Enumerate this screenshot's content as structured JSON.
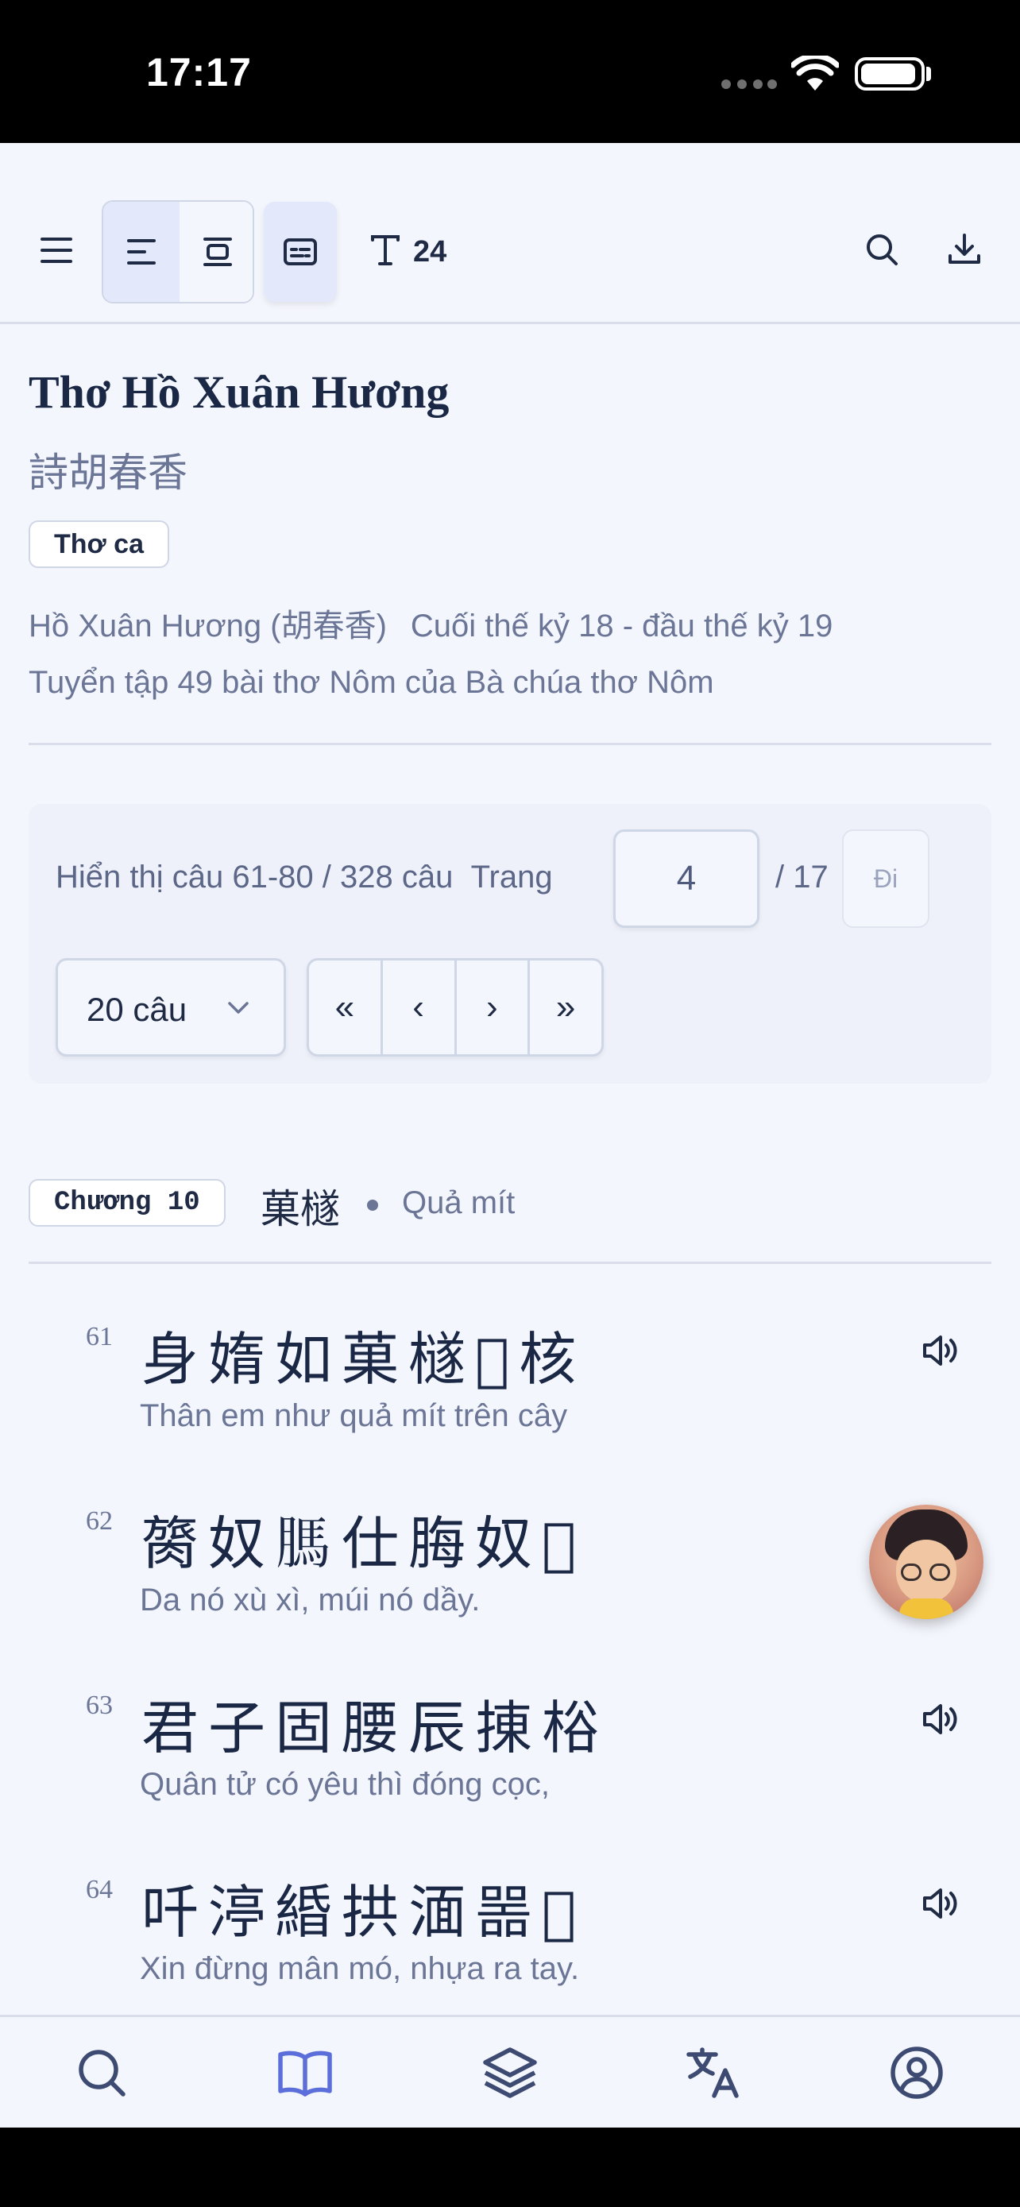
{
  "status_bar": {
    "time": "17:17"
  },
  "toolbar": {
    "font_size": "24",
    "icons": [
      "menu-icon",
      "align-left-icon",
      "align-center-icon",
      "caption-icon",
      "text-size-icon",
      "search-icon",
      "download-icon"
    ]
  },
  "work": {
    "title": "Thơ Hồ Xuân Hương",
    "title_han": "詩胡春香",
    "genre": "Thơ ca",
    "author": "Hồ Xuân Hương (胡春香)",
    "period": "Cuối thế kỷ 18 - đầu thế kỷ 19",
    "description": "Tuyển tập 49 bài thơ Nôm của Bà chúa thơ Nôm"
  },
  "pagination": {
    "info": "Hiển thị câu 61-80 / 328 câu",
    "page_label": "Trang",
    "current_page": "4",
    "total_pages": "/ 17",
    "go_label": "Đi",
    "per_page": "20 câu",
    "first_label": "«",
    "prev_label": "‹",
    "next_label": "›",
    "last_label": "»"
  },
  "chapter": {
    "badge": "Chương 10",
    "title_han": "菓檖",
    "title_viet": "Quả mít"
  },
  "verses": [
    {
      "num": "61",
      "han": "身媠如菓檖𨕭核",
      "viet": "Thân em như quả mít trên cây"
    },
    {
      "num": "62",
      "han": "膐奴𦟐仕脢奴𦛌",
      "viet": "Da nó xù xì, múi nó dầy."
    },
    {
      "num": "63",
      "han": "君子固腰辰㨂㭲",
      "viet": "Quân tử có yêu thì đóng cọc,"
    },
    {
      "num": "64",
      "han": "吀渟緍拱湎噐𢬣",
      "viet": "Xin đừng mân mó, nhựa ra tay."
    }
  ],
  "tabbar": {
    "tabs": [
      "search-icon",
      "book-icon",
      "layers-icon",
      "translate-icon",
      "profile-icon"
    ],
    "active_color": "#5b6ed9",
    "inactive_color": "#3d4a72"
  }
}
